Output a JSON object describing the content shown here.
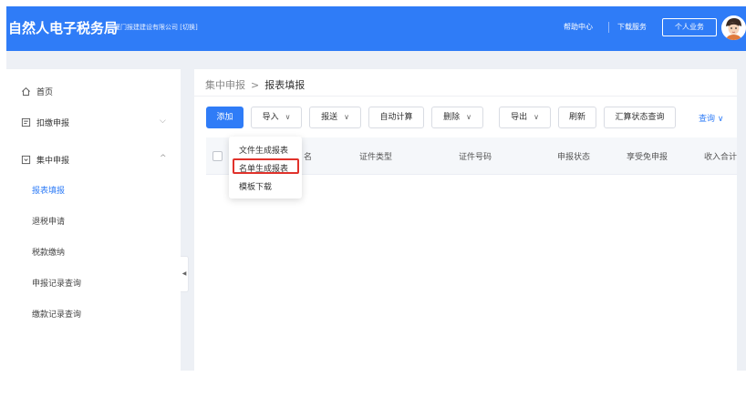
{
  "header": {
    "app_title": "自然人电子税务局",
    "company": "厦门报建建设有限公司 [切换]",
    "help_label": "帮助中心",
    "download_label": "下载服务",
    "personal_label": "个人业务",
    "brand_color": "#2f7cf7"
  },
  "sidebar": {
    "home": "首页",
    "withholding": "扣缴申报",
    "centralized": "集中申报",
    "sub_items": [
      "报表填报",
      "退税申请",
      "税款缴纳",
      "申报记录查询",
      "缴款记录查询"
    ],
    "active_sub": "报表填报"
  },
  "breadcrumb": {
    "parent": "集中申报",
    "separator": ">",
    "current": "报表填报"
  },
  "toolbar": {
    "add": "添加",
    "import": "导入",
    "submit": "报送",
    "auto_calc": "自动计算",
    "delete": "删除",
    "export": "导出",
    "refresh": "刷新",
    "summary_query": "汇算状态查询",
    "query": "查询"
  },
  "table": {
    "headers": [
      "名",
      "证件类型",
      "证件号码",
      "申报状态",
      "享受免申报",
      "收入合计"
    ]
  },
  "import_menu": {
    "items": [
      "文件生成报表",
      "名单生成报表",
      "模板下载"
    ],
    "highlighted": "名单生成报表"
  }
}
